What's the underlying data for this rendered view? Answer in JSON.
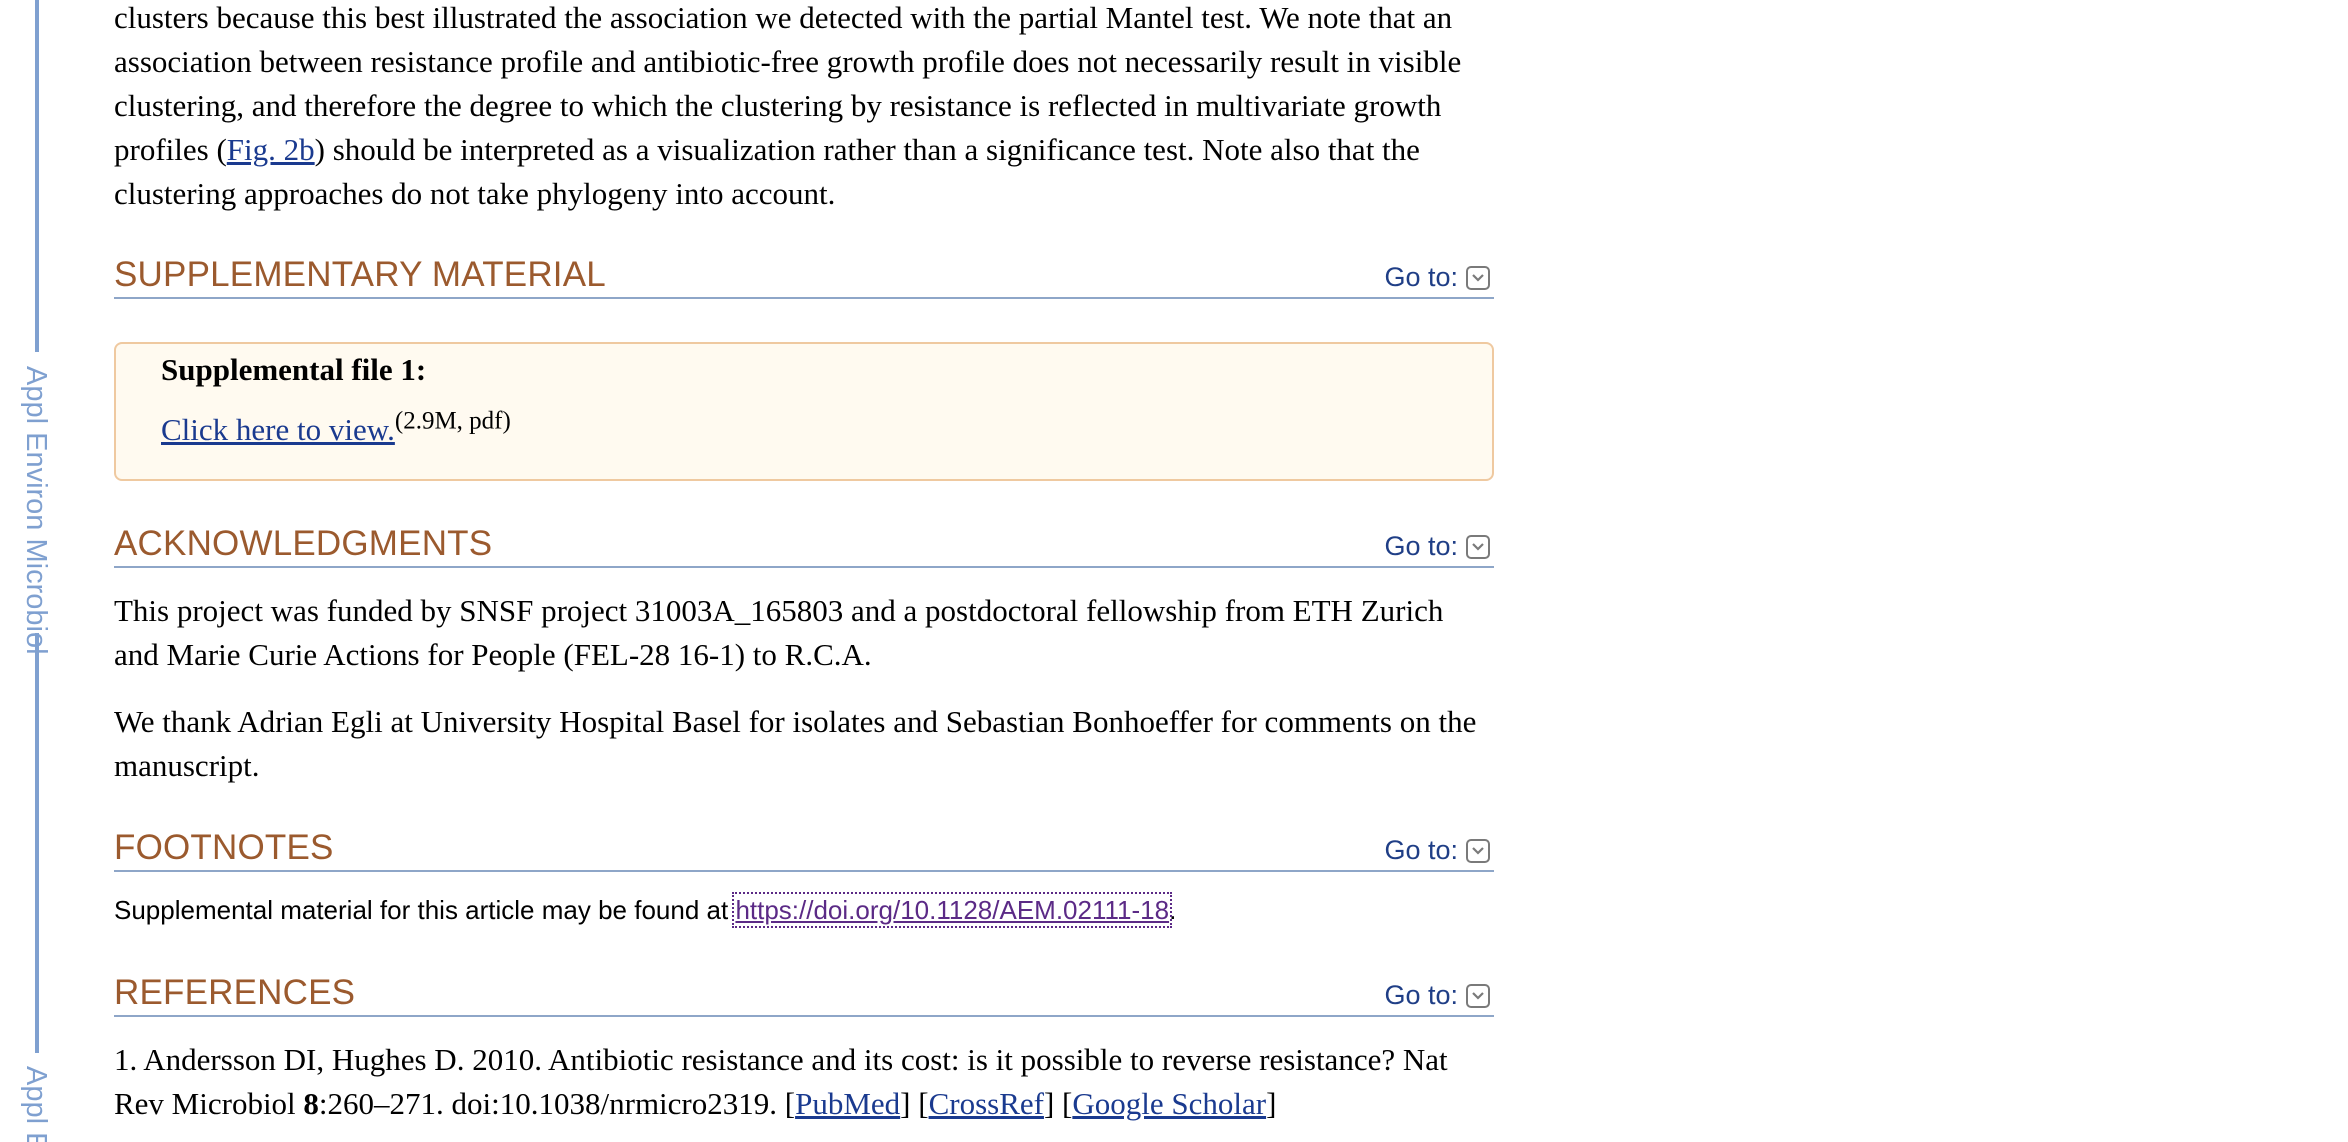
{
  "rail": {
    "label_1": "Appl Environ Microbiol",
    "label_2": "Appl E"
  },
  "intro": {
    "text_before_link": "clusters because this best illustrated the association we detected with the partial Mantel test. We note that an association between resistance profile and antibiotic-free growth profile does not necessarily result in visible clustering, and therefore the degree to which the clustering by resistance is reflected in multivariate growth profiles (",
    "link": "Fig. 2b",
    "text_after_link": ") should be interpreted as a visualization rather than a significance test. Note also that the clustering approaches do not take phylogeny into account."
  },
  "goto_label": "Go to:",
  "sections": {
    "supplementary": {
      "title": "SUPPLEMENTARY MATERIAL",
      "file_title": "Supplemental file 1:",
      "view_link": "Click here to view.",
      "meta": "(2.9M, pdf)"
    },
    "acknowledgments": {
      "title": "ACKNOWLEDGMENTS",
      "para_1": "This project was funded by SNSF project 31003A_165803 and a postdoctoral fellowship from ETH Zurich and Marie Curie Actions for People (FEL-28 16-1) to R.C.A.",
      "para_2": "We thank Adrian Egli at University Hospital Basel for isolates and Sebastian Bonhoeffer for comments on the manuscript."
    },
    "footnotes": {
      "title": "FOOTNOTES",
      "text": "Supplemental material for this article may be found at ",
      "doi_link": "https://doi.org/10.1128/AEM.02111-18",
      "end": "."
    },
    "references": {
      "title": "REFERENCES",
      "ref_1": {
        "number": "1.",
        "text": " Andersson DI, Hughes D. 2010. Antibiotic resistance and its cost: is it possible to reverse resistance? Nat Rev Microbiol ",
        "volume": "8",
        "pages": ":260–271. doi:10.1038/nrmicro2319. [",
        "pubmed": "PubMed",
        "sep_1": "] [",
        "crossref": "CrossRef",
        "sep_2": "] [",
        "scholar": "Google Scholar",
        "end": "]"
      }
    }
  }
}
